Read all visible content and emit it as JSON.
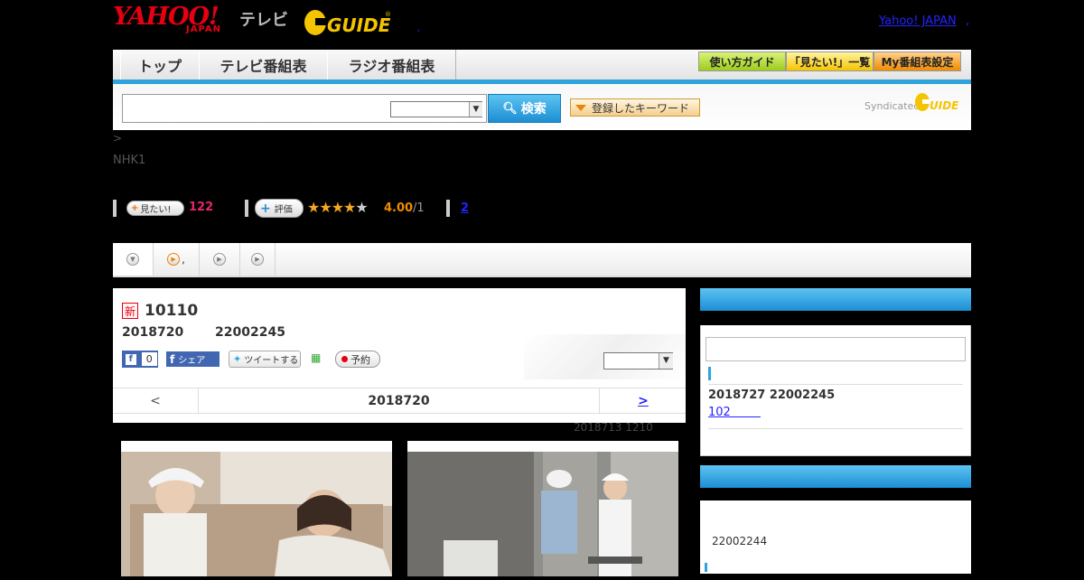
{
  "header": {
    "yahoo_logo": "YAHOO!",
    "japan_logo": "JAPAN",
    "tv_label": "テレビ",
    "gguide_logo": "G GUIDE",
    "yahoo_japan_link": "Yahoo! JAPAN",
    "comma": ",",
    "dot": ","
  },
  "nav": {
    "tabs": [
      "トップ",
      "テレビ番組表",
      "ラジオ番組表"
    ],
    "right_buttons": [
      "使い方ガイド",
      "「見たい!」一覧",
      "My番組表設定"
    ]
  },
  "search": {
    "input_value": "",
    "select_value": "",
    "button_label": "検索",
    "keyword_button": "登録したキーワード",
    "syndicated": "Syndicated",
    "synd_logo": "G GUIDE"
  },
  "breadcrumb": ">",
  "channel": "NHK1",
  "actions": {
    "want_label": "見たい!",
    "want_count": "122",
    "rate_label": "評価",
    "stars": 4,
    "rating_value": "4.00",
    "rating_count": "/1",
    "link_2": "2"
  },
  "tabs": {
    "items": [
      "",
      ",",
      "",
      ""
    ]
  },
  "program": {
    "new_badge": "新",
    "title": "10110",
    "date": "2018720",
    "time": "22002245",
    "fb_like": "f",
    "fb_like_count": "0",
    "fb_share": "シェア",
    "tweet": "ツイートする",
    "reserve": "予約",
    "panel_select": ""
  },
  "date_nav": {
    "prev": "<",
    "current": "2018720",
    "next": ">"
  },
  "update_note": "2018713  1210",
  "sidebar": {
    "item_datetime": "2018727  22002245",
    "item_link": "102",
    "second_time": "22002244"
  },
  "colors": {
    "accent": "#2ea3dc",
    "brand_red": "#e60012",
    "link": "#2323ff",
    "want_count": "#e8246d",
    "rating": "#f08c00"
  }
}
